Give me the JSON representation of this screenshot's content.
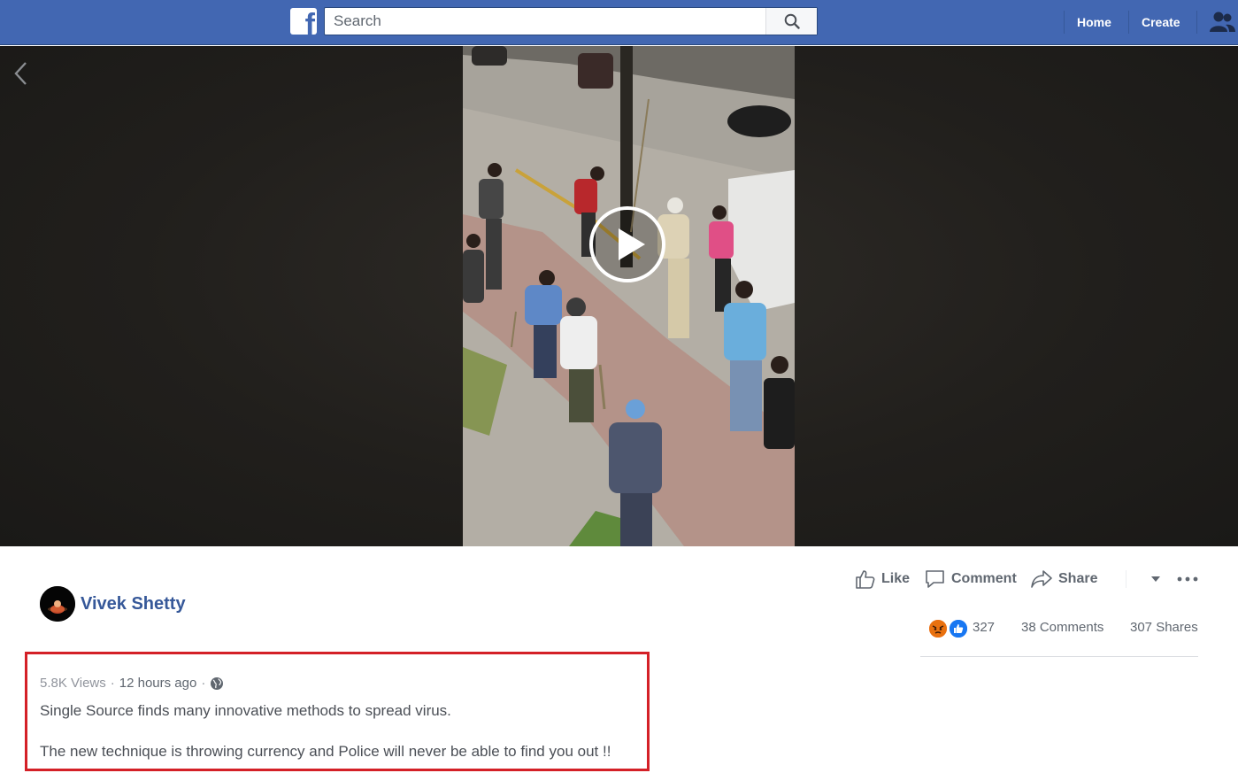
{
  "header": {
    "logo_icon": "facebook-f-icon",
    "search_placeholder": "Search",
    "nav": {
      "home_label": "Home",
      "create_label": "Create"
    },
    "colors": {
      "bar": "#4267b2",
      "link": "#365899"
    }
  },
  "post": {
    "author_name": "Vivek Shetty",
    "actions": {
      "like_label": "Like",
      "comment_label": "Comment",
      "share_label": "Share"
    },
    "reactions": {
      "icons": [
        "angry-reaction-icon",
        "like-reaction-icon"
      ],
      "count": "327"
    },
    "comments_count": "38 Comments",
    "shares_count": "307 Shares",
    "views": "5.8K Views",
    "time": "12 hours ago",
    "audience_icon": "globe-icon",
    "caption_line1": "Single Source finds many innovative methods to spread virus.",
    "caption_line2": "The new technique is throwing currency and Police will never be able to find you out !!",
    "highlight_color": "#d42027"
  }
}
